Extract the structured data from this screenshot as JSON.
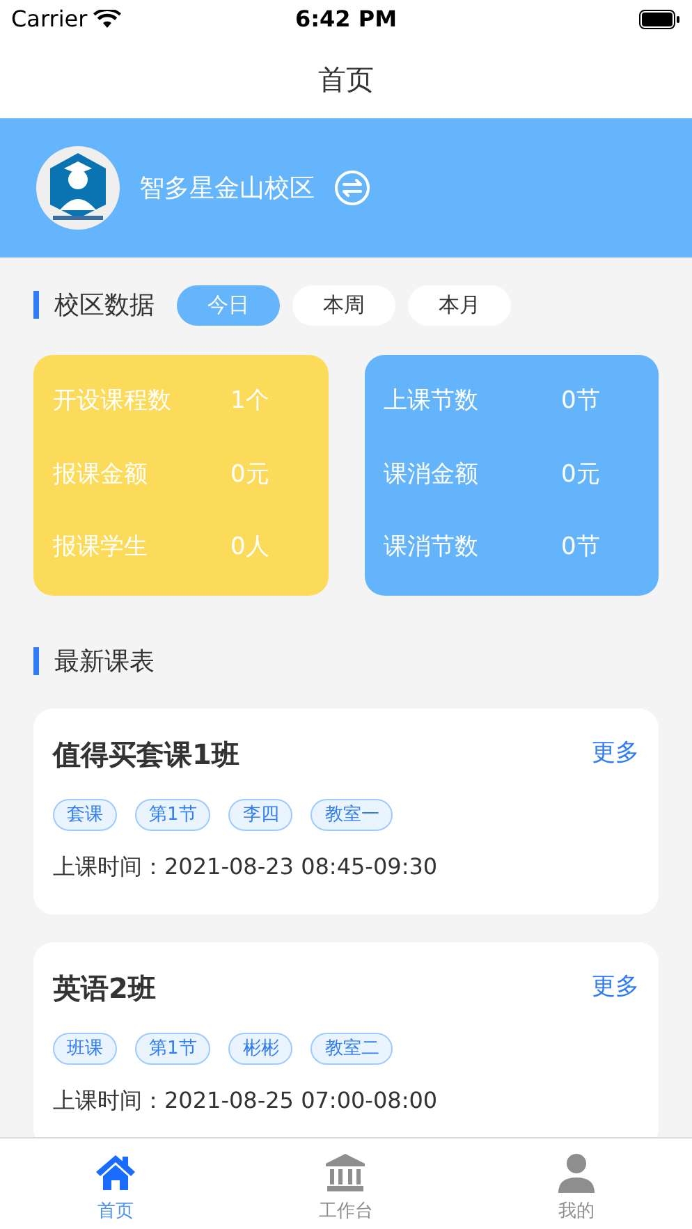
{
  "status_bar": {
    "carrier": "Carrier",
    "time": "6:42 PM"
  },
  "nav": {
    "title": "首页"
  },
  "campus": {
    "name": "智多星金山校区"
  },
  "campus_data": {
    "title": "校区数据",
    "filters": [
      {
        "label": "今日",
        "selected": true
      },
      {
        "label": "本周",
        "selected": false
      },
      {
        "label": "本月",
        "selected": false
      }
    ],
    "cards": [
      {
        "color": "#fddb5a",
        "stats": [
          {
            "label": "开设课程数",
            "value": "1个"
          },
          {
            "label": "报课金额",
            "value": "0元"
          },
          {
            "label": "报课学生",
            "value": "0人"
          }
        ]
      },
      {
        "color": "#64b4fc",
        "stats": [
          {
            "label": "上课节数",
            "value": "0节"
          },
          {
            "label": "课消金额",
            "value": "0元"
          },
          {
            "label": "课消节数",
            "value": "0节"
          }
        ]
      }
    ]
  },
  "schedule": {
    "title": "最新课表",
    "items": [
      {
        "name": "值得买套课1班",
        "more": "更多",
        "tags": [
          "套课",
          "第1节",
          "李四",
          "教室一"
        ],
        "time": "上课时间：2021-08-23 08:45-09:30"
      },
      {
        "name": "英语2班",
        "more": "更多",
        "tags": [
          "班课",
          "第1节",
          "彬彬",
          "教室二"
        ],
        "time": "上课时间：2021-08-25 07:00-08:00"
      }
    ]
  },
  "tab_bar": [
    {
      "label": "首页",
      "kind": "home",
      "selected": true
    },
    {
      "label": "工作台",
      "kind": "bank",
      "selected": false
    },
    {
      "label": "我的",
      "kind": "person",
      "selected": false
    }
  ]
}
